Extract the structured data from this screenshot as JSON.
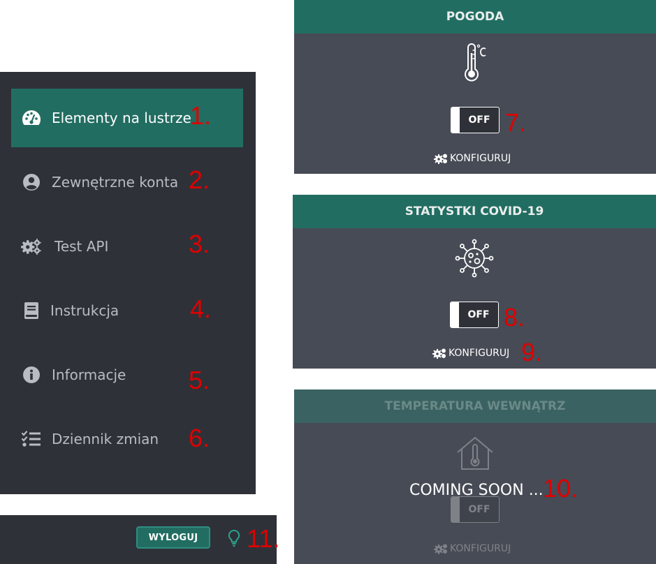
{
  "sidebar": {
    "items": [
      {
        "label": "Elementy na lustrze",
        "icon": "dashboard-icon",
        "active": true,
        "number": "1."
      },
      {
        "label": "Zewnętrzne konta",
        "icon": "user-circle-icon",
        "active": false,
        "number": "2."
      },
      {
        "label": "Test API",
        "icon": "cogs-icon",
        "active": false,
        "number": "3."
      },
      {
        "label": "Instrukcja",
        "icon": "book-icon",
        "active": false,
        "number": "4."
      },
      {
        "label": "Informacje",
        "icon": "info-circle-icon",
        "active": false,
        "number": "5."
      },
      {
        "label": "Dziennik zmian",
        "icon": "tasks-list-icon",
        "active": false,
        "number": "6."
      }
    ]
  },
  "bottombar": {
    "logout_label": "WYLOGUJ",
    "bulb_icon": "lightbulb-icon",
    "number": "11."
  },
  "widgets": [
    {
      "title": "POGODA",
      "icon": "thermometer-celsius-icon",
      "toggle": "OFF",
      "toggle_number": "7.",
      "config_label": "KONFIGURUJ",
      "config_number": ""
    },
    {
      "title": "STATYSTKI COVID-19",
      "icon": "virus-icon",
      "toggle": "OFF",
      "toggle_number": "8.",
      "config_label": "KONFIGURUJ",
      "config_number": "9."
    },
    {
      "title": "TEMPERATURA WEWNĄTRZ",
      "icon": "house-thermometer-icon",
      "toggle": "OFF",
      "config_label": "KONFIGURUJ",
      "overlay": "COMING SOON ...",
      "overlay_number": "10."
    }
  ],
  "colors": {
    "accent": "#226d62",
    "sidebar_bg": "#2f3138",
    "widget_bg": "#474b55",
    "annotation": "#e00000"
  }
}
